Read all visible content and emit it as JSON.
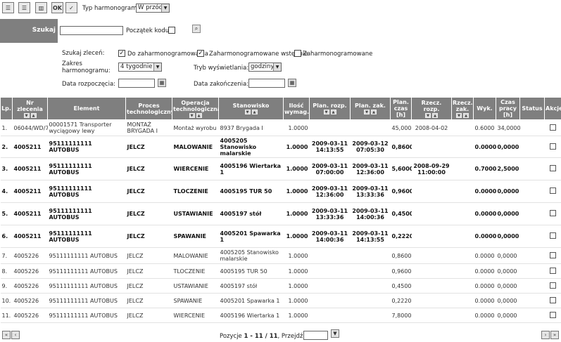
{
  "toolbar": {
    "type_label": "Typ harmonogramu:",
    "type_value": "W przód",
    "ok_label": "OK"
  },
  "search": {
    "label": "Szukaj",
    "code_start_label": "Początek kodu"
  },
  "filters": {
    "orders_label": "Szukaj zleceń:",
    "opt1_label": "Do zaharmonogramowania",
    "opt1_checked": "✓",
    "opt2_label": "Zaharmonogramowane wstępnie",
    "opt2_checked": "✓",
    "opt3_label": "Zaharmonogramowane",
    "opt3_checked": "",
    "range_label": "Zakres harmonogramu:",
    "range_value": "4 tygodnie",
    "mode_label": "Tryb wyświetlania:",
    "mode_value": "godziny",
    "start_label": "Data rozpoczęcia:",
    "end_label": "Data zakończenia:"
  },
  "columns": [
    "Lp.",
    "Nr zlecenia",
    "Element",
    "Proces technologiczny",
    "Operacja technologiczna",
    "Stanowisko",
    "Ilość wymag.",
    "Plan. rozp.",
    "Plan. zak.",
    "Plan. czas [h]",
    "Rzecz. rozp.",
    "Rzecz. zak.",
    "Wyk.",
    "Czas pracy [h]",
    "Status",
    "Akcje"
  ],
  "rows": [
    {
      "lp": "1.",
      "nr": "06044/WD/7",
      "el": "00001571 Transporter wyciągowy lewy",
      "proc": "MONTAŻ BRYGADA I",
      "op": "Montaż wyrobu",
      "st": "8937 Brygada I",
      "il": "1.0000",
      "pr": "",
      "pz": "",
      "pc": "45,0000",
      "rr": "2008-04-02",
      "rz": "",
      "wyk": "0.6000",
      "cp": "34,0000",
      "status": "",
      "bold": false
    },
    {
      "lp": "2.",
      "nr": "4005211",
      "el": "95111111111 AUTOBUS",
      "proc": "JELCZ",
      "op": "MALOWANIE",
      "st": "4005205 Stanowisko malarskie",
      "il": "1.0000",
      "pr": "2009-03-11 14:13:55",
      "pz": "2009-03-12 07:05:30",
      "pc": "0,8600",
      "rr": "",
      "rz": "",
      "wyk": "0.0000",
      "cp": "0,0000",
      "status": "",
      "bold": true
    },
    {
      "lp": "3.",
      "nr": "4005211",
      "el": "95111111111 AUTOBUS",
      "proc": "JELCZ",
      "op": "WIERCENIE",
      "st": "4005196 Wiertarka 1",
      "il": "1.0000",
      "pr": "2009-03-11 07:00:00",
      "pz": "2009-03-11 12:36:00",
      "pc": "5,6000",
      "rr": "2008-09-29 11:00:00",
      "rz": "",
      "wyk": "0.7000",
      "cp": "2,5000",
      "status": "",
      "bold": true
    },
    {
      "lp": "4.",
      "nr": "4005211",
      "el": "95111111111 AUTOBUS",
      "proc": "JELCZ",
      "op": "TLOCZENIE",
      "st": "4005195 TUR 50",
      "il": "1.0000",
      "pr": "2009-03-11 12:36:00",
      "pz": "2009-03-11 13:33:36",
      "pc": "0,9600",
      "rr": "",
      "rz": "",
      "wyk": "0.0000",
      "cp": "0,0000",
      "status": "",
      "bold": true
    },
    {
      "lp": "5.",
      "nr": "4005211",
      "el": "95111111111 AUTOBUS",
      "proc": "JELCZ",
      "op": "USTAWIANIE",
      "st": "4005197 stół",
      "il": "1.0000",
      "pr": "2009-03-11 13:33:36",
      "pz": "2009-03-11 14:00:36",
      "pc": "0,4500",
      "rr": "",
      "rz": "",
      "wyk": "0.0000",
      "cp": "0,0000",
      "status": "",
      "bold": true
    },
    {
      "lp": "6.",
      "nr": "4005211",
      "el": "95111111111 AUTOBUS",
      "proc": "JELCZ",
      "op": "SPAWANIE",
      "st": "4005201 Spawarka 1",
      "il": "1.0000",
      "pr": "2009-03-11 14:00:36",
      "pz": "2009-03-11 14:13:55",
      "pc": "0,2220",
      "rr": "",
      "rz": "",
      "wyk": "0.0000",
      "cp": "0,0000",
      "status": "",
      "bold": true
    },
    {
      "lp": "7.",
      "nr": "4005226",
      "el": "95111111111 AUTOBUS",
      "proc": "JELCZ",
      "op": "MALOWANIE",
      "st": "4005205 Stanowisko malarskie",
      "il": "1.0000",
      "pr": "",
      "pz": "",
      "pc": "0,8600",
      "rr": "",
      "rz": "",
      "wyk": "0.0000",
      "cp": "0,0000",
      "status": "",
      "bold": false
    },
    {
      "lp": "8.",
      "nr": "4005226",
      "el": "95111111111 AUTOBUS",
      "proc": "JELCZ",
      "op": "TLOCZENIE",
      "st": "4005195 TUR 50",
      "il": "1.0000",
      "pr": "",
      "pz": "",
      "pc": "0,9600",
      "rr": "",
      "rz": "",
      "wyk": "0.0000",
      "cp": "0,0000",
      "status": "",
      "bold": false
    },
    {
      "lp": "9.",
      "nr": "4005226",
      "el": "95111111111 AUTOBUS",
      "proc": "JELCZ",
      "op": "USTAWIANIE",
      "st": "4005197 stół",
      "il": "1.0000",
      "pr": "",
      "pz": "",
      "pc": "0,4500",
      "rr": "",
      "rz": "",
      "wyk": "0.0000",
      "cp": "0,0000",
      "status": "",
      "bold": false
    },
    {
      "lp": "10.",
      "nr": "4005226",
      "el": "95111111111 AUTOBUS",
      "proc": "JELCZ",
      "op": "SPAWANIE",
      "st": "4005201 Spawarka 1",
      "il": "1.0000",
      "pr": "",
      "pz": "",
      "pc": "0,2220",
      "rr": "",
      "rz": "",
      "wyk": "0.0000",
      "cp": "0,0000",
      "status": "",
      "bold": false
    },
    {
      "lp": "11.",
      "nr": "4005226",
      "el": "95111111111 AUTOBUS",
      "proc": "JELCZ",
      "op": "WIERCENIE",
      "st": "4005196 Wiertarka 1",
      "il": "1.0000",
      "pr": "",
      "pz": "",
      "pc": "7,8000",
      "rr": "",
      "rz": "",
      "wyk": "0.0000",
      "cp": "0,0000",
      "status": "",
      "bold": false
    }
  ],
  "pager": {
    "prefix": "Pozycje ",
    "range": "1 - 11 / 11",
    "suffix": ", Przejdź do"
  }
}
